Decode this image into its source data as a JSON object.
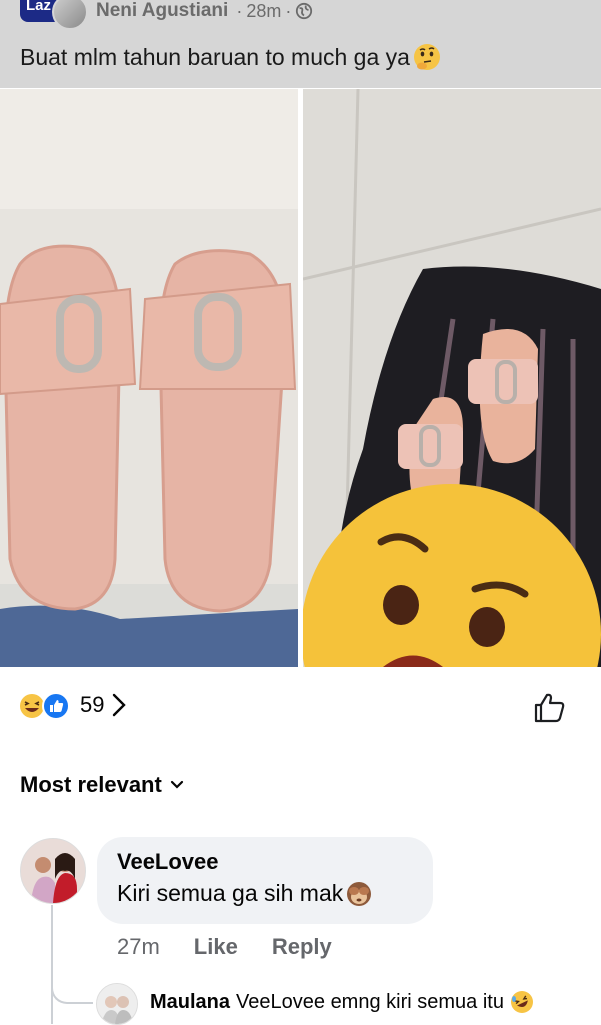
{
  "post": {
    "group_badge": "Laz",
    "author": "Neni Agustiani",
    "time": "28m",
    "separator": "·",
    "caption": "Buat mlm tahun baruan to much ga ya",
    "caption_emoji": "thinking-face-emoji"
  },
  "reactions": {
    "count": "59",
    "types": [
      "haha",
      "like"
    ]
  },
  "comments_sort": {
    "label": "Most relevant"
  },
  "comments": [
    {
      "name": "VeeLovee",
      "text": "Kiri semua ga sih mak",
      "emoji": "see-no-evil-monkey-emoji",
      "time": "27m",
      "like_label": "Like",
      "reply_label": "Reply"
    }
  ],
  "reply": {
    "name": "Maulana",
    "text": "VeeLovee emng kiri semua itu",
    "emoji": "rolling-laughing-emoji"
  },
  "colors": {
    "header_overlay": "#d6d6d6",
    "bubble": "#f0f2f5",
    "like_blue": "#1877f2",
    "secondary_text": "#65676b",
    "sandal_pink": "#e9b4a0"
  }
}
